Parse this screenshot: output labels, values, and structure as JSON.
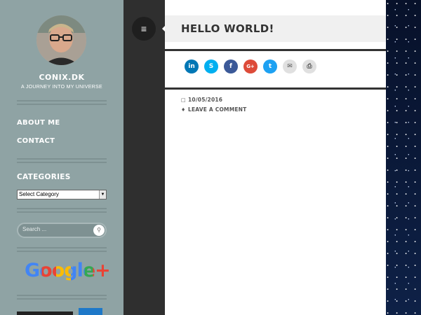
{
  "site": {
    "title": "CONIX.DK",
    "description": "A JOURNEY INTO MY UNIVERSE"
  },
  "nav": {
    "items": [
      {
        "label": "ABOUT ME"
      },
      {
        "label": "CONTACT"
      }
    ]
  },
  "categories": {
    "title": "CATEGORIES",
    "selected": "Select Category"
  },
  "search": {
    "placeholder": "Search ..."
  },
  "google_plus": {
    "text": "Google+"
  },
  "post": {
    "title": "HELLO WORLD!",
    "date": "10/05/2016",
    "comment_link": "LEAVE A COMMENT"
  },
  "share": {
    "buttons": [
      {
        "icon": "linkedin-icon",
        "glyph": "in",
        "color": "#0077b5"
      },
      {
        "icon": "skype-icon",
        "glyph": "S",
        "color": "#00aff0"
      },
      {
        "icon": "facebook-icon",
        "glyph": "f",
        "color": "#3b5998"
      },
      {
        "icon": "google-plus-icon",
        "glyph": "G+",
        "color": "#dd4b39"
      },
      {
        "icon": "twitter-icon",
        "glyph": "t",
        "color": "#1da1f2"
      },
      {
        "icon": "email-icon",
        "glyph": "✉",
        "color": "#e0e0e0"
      },
      {
        "icon": "print-icon",
        "glyph": "⎙",
        "color": "#e0e0e0"
      }
    ]
  },
  "colors": {
    "sidebar": "#8fa3a4",
    "dark_column": "#2f2f2f",
    "content": "#ffffff"
  }
}
